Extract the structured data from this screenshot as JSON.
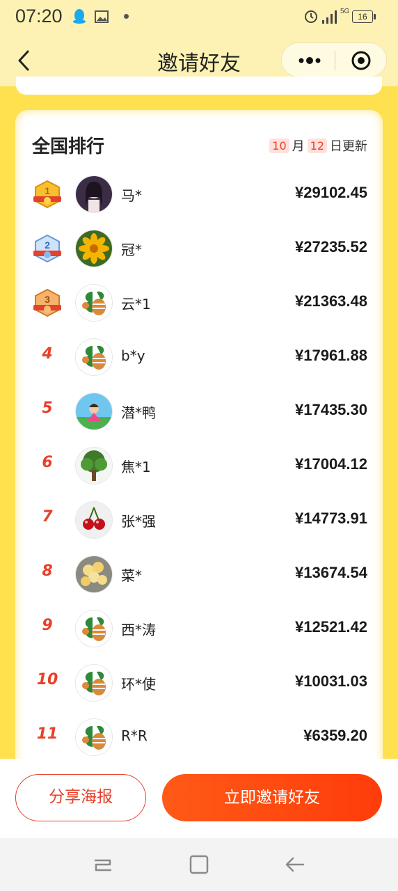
{
  "status_bar": {
    "time": "07:20",
    "network": "5G",
    "battery": "16"
  },
  "header": {
    "title": "邀请好友"
  },
  "ranking": {
    "title": "全国排行",
    "update": {
      "month": "10",
      "month_unit": "月",
      "day": "12",
      "day_suffix": "日更新"
    },
    "rows": [
      {
        "rank": "1",
        "name": "马*",
        "amount": "¥29102.45",
        "avatar": "girl-photo"
      },
      {
        "rank": "2",
        "name": "冠*",
        "amount": "¥27235.52",
        "avatar": "yellow-flower"
      },
      {
        "rank": "3",
        "name": "云*1",
        "amount": "¥21363.48",
        "avatar": "default-bee"
      },
      {
        "rank": "4",
        "name": "b*y",
        "amount": "¥17961.88",
        "avatar": "default-bee"
      },
      {
        "rank": "5",
        "name": "潜*鸭",
        "amount": "¥17435.30",
        "avatar": "cartoon-girl"
      },
      {
        "rank": "6",
        "name": "焦*1",
        "amount": "¥17004.12",
        "avatar": "tree"
      },
      {
        "rank": "7",
        "name": "张*强",
        "amount": "¥14773.91",
        "avatar": "cherries"
      },
      {
        "rank": "8",
        "name": "菜*",
        "amount": "¥13674.54",
        "avatar": "flower-bouquet"
      },
      {
        "rank": "9",
        "name": "西*涛",
        "amount": "¥12521.42",
        "avatar": "default-bee"
      },
      {
        "rank": "10",
        "name": "环*使",
        "amount": "¥10031.03",
        "avatar": "default-bee"
      },
      {
        "rank": "11",
        "name": "R*R",
        "amount": "¥6359.20",
        "avatar": "default-bee"
      }
    ]
  },
  "actions": {
    "share_label": "分享海报",
    "invite_label": "立即邀请好友"
  },
  "colors": {
    "accent": "#e8402a",
    "invite_button": "#ff4a10",
    "background": "#ffe14f",
    "header_bg": "#fdf2b3"
  }
}
